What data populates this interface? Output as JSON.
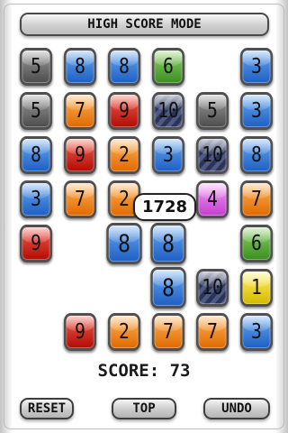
{
  "header": {
    "title": "HIGH SCORE MODE"
  },
  "board": {
    "cells": [
      {
        "row": 0,
        "col": 0,
        "value": "5",
        "color": "gray"
      },
      {
        "row": 0,
        "col": 1,
        "value": "8",
        "color": "blue"
      },
      {
        "row": 0,
        "col": 2,
        "value": "8",
        "color": "blue"
      },
      {
        "row": 0,
        "col": 3,
        "value": "6",
        "color": "green"
      },
      {
        "row": 0,
        "col": 5,
        "value": "3",
        "color": "blue"
      },
      {
        "row": 1,
        "col": 0,
        "value": "5",
        "color": "gray"
      },
      {
        "row": 1,
        "col": 1,
        "value": "7",
        "color": "orange"
      },
      {
        "row": 1,
        "col": 2,
        "value": "9",
        "color": "red"
      },
      {
        "row": 1,
        "col": 3,
        "value": "10",
        "color": "navy"
      },
      {
        "row": 1,
        "col": 4,
        "value": "5",
        "color": "gray"
      },
      {
        "row": 1,
        "col": 5,
        "value": "3",
        "color": "blue"
      },
      {
        "row": 2,
        "col": 0,
        "value": "8",
        "color": "blue"
      },
      {
        "row": 2,
        "col": 1,
        "value": "9",
        "color": "red"
      },
      {
        "row": 2,
        "col": 2,
        "value": "2",
        "color": "orange"
      },
      {
        "row": 2,
        "col": 3,
        "value": "3",
        "color": "blue"
      },
      {
        "row": 2,
        "col": 4,
        "value": "10",
        "color": "navy"
      },
      {
        "row": 2,
        "col": 5,
        "value": "8",
        "color": "blue"
      },
      {
        "row": 3,
        "col": 0,
        "value": "3",
        "color": "blue"
      },
      {
        "row": 3,
        "col": 1,
        "value": "7",
        "color": "orange"
      },
      {
        "row": 3,
        "col": 2,
        "value": "2",
        "color": "orange"
      },
      {
        "row": 3,
        "col": 4,
        "value": "4",
        "color": "pink"
      },
      {
        "row": 3,
        "col": 5,
        "value": "7",
        "color": "orange"
      },
      {
        "row": 4,
        "col": 0,
        "value": "9",
        "color": "red"
      },
      {
        "row": 4,
        "col": 2,
        "value": "8",
        "color": "blue",
        "selected": true
      },
      {
        "row": 4,
        "col": 3,
        "value": "8",
        "color": "blue",
        "selected": true
      },
      {
        "row": 4,
        "col": 5,
        "value": "6",
        "color": "green"
      },
      {
        "row": 5,
        "col": 3,
        "value": "8",
        "color": "blue",
        "selected": true
      },
      {
        "row": 5,
        "col": 4,
        "value": "10",
        "color": "navy"
      },
      {
        "row": 5,
        "col": 5,
        "value": "1",
        "color": "yellow"
      },
      {
        "row": 6,
        "col": 1,
        "value": "9",
        "color": "red"
      },
      {
        "row": 6,
        "col": 2,
        "value": "2",
        "color": "orange"
      },
      {
        "row": 6,
        "col": 3,
        "value": "7",
        "color": "orange"
      },
      {
        "row": 6,
        "col": 4,
        "value": "7",
        "color": "orange"
      },
      {
        "row": 6,
        "col": 5,
        "value": "3",
        "color": "blue"
      }
    ]
  },
  "bubble": {
    "value": "1728"
  },
  "score": {
    "label": "SCORE:",
    "value": "73"
  },
  "buttons": {
    "reset": "RESET",
    "top": "TOP",
    "undo": "UNDO"
  }
}
